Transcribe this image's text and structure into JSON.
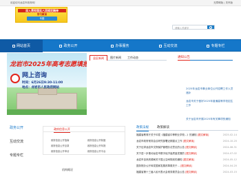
{
  "topbar": {
    "welcome": "欢迎访问龙岩市政府网！",
    "links": "无障碍版 | 关怀版"
  },
  "banner": {
    "line1": "深入贯彻落实八项规定精神",
    "line2": "学习教育",
    "line3": "专题"
  },
  "search": {
    "placeholder": "请输入关键字"
  },
  "nav": {
    "home": "网站首页",
    "items": [
      "政务公开",
      "办事服务",
      "互动交流",
      "专题专栏"
    ]
  },
  "hero": {
    "title": "龙岩市2025年高考志愿填报",
    "subtitle": "网上咨询",
    "date": "时间：6月26日9:30-11:00",
    "place": "地点：龙岩市人民政府网站"
  },
  "tabs1": [
    "县区新闻",
    "图片新闻",
    "工作动态"
  ],
  "notice": {
    "head": "通知公告",
    "items": [
      "2025年龙岩市事业单位公开招聘工作人员递补",
      "龙岩市关于做好2025年普通高等学校招生工作",
      "关于龙岩市开展2025年有关事项的通知"
    ]
  },
  "side": [
    "政务公开",
    "互动交流",
    "专题专栏"
  ],
  "gov": {
    "head": "政府信息公开",
    "links": [
      "政府信息公开指南",
      "政府信息公开制度",
      "政府信息公开目录",
      "政府信息公开年报",
      "政府信息公开申请",
      "政府信息公开平台"
    ]
  },
  "org": "机构概况",
  "policy": {
    "tabs": [
      "政策法规",
      "政策解读"
    ],
    "tag": "[图文解读]",
    "rows": [
      {
        "title": "福建省教育厅关于印发《福建省中等职业学校…》的通知",
        "date": "2025-02-14"
      },
      {
        "title": "龙岩市政府常务会议研究部署近期重点工作",
        "date": "2024-10-20"
      },
      {
        "title": "关于征求龙岩市文物保护管理办法意见的公告",
        "date": "2024-08-31"
      },
      {
        "title": "关于进一步推动龙岩市数字经济高质量发展的",
        "date": "2024-07-02"
      },
      {
        "title": "龙岩市自然资源局关于国土空间规划的通知",
        "date": "2024-05-12"
      },
      {
        "title": "国务院办公厅转发国家发展改革委关于…",
        "date": "2024-04-20"
      },
      {
        "title": "福建省第十三届人民代表大会常务委员会公告",
        "date": "2024-03-15"
      }
    ]
  }
}
